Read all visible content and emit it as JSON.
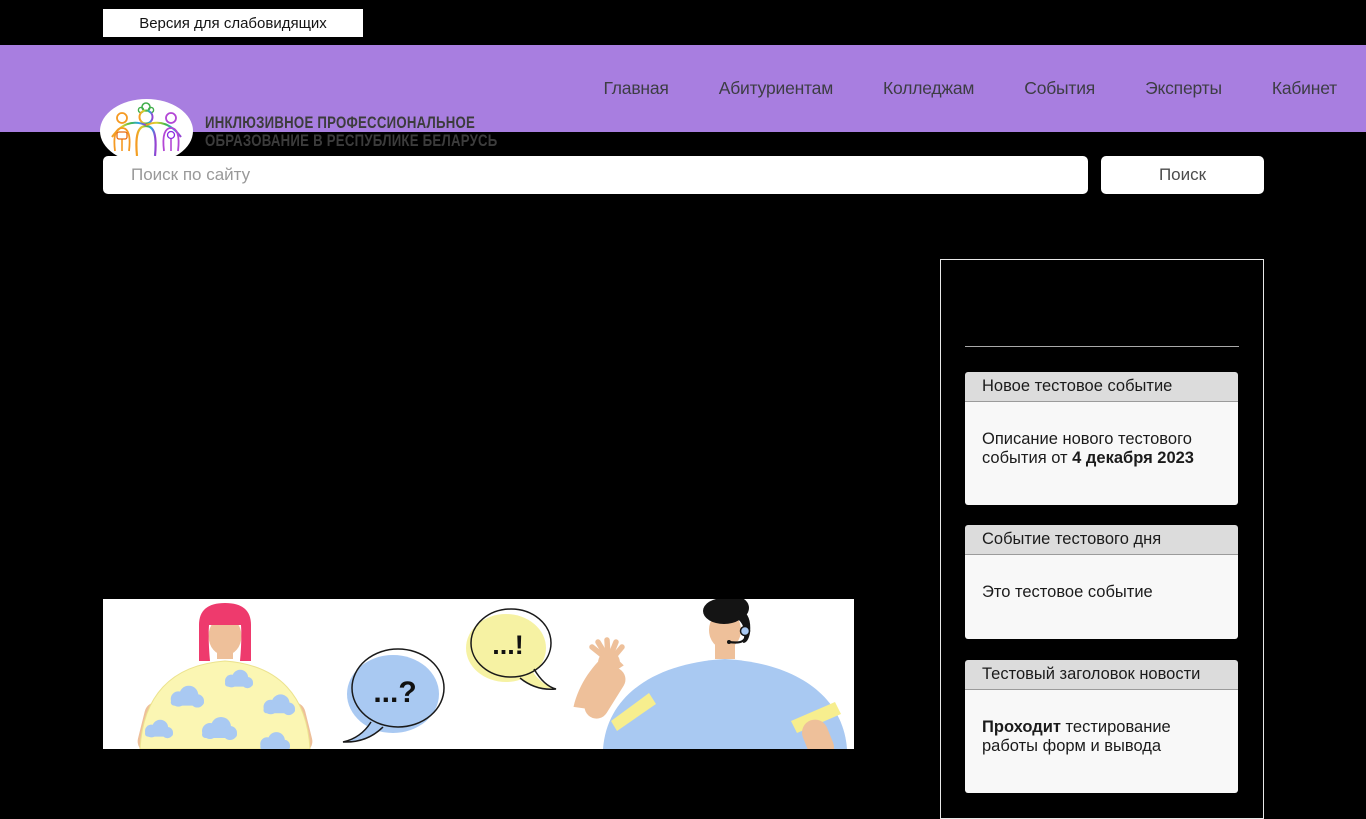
{
  "colors": {
    "header-purple": "#a87ee0",
    "card-header-bg": "#dcdcdc",
    "card-body-bg": "#f8f8f8",
    "bubble-blue": "#a9c9f2",
    "bubble-yellow": "#f6f2a3",
    "hair-pink": "#ee3a6d",
    "skin": "#eec09a",
    "shirt-yellow": "#fbf6b3",
    "shirt-blue": "#a9c9f2"
  },
  "top_bar": {
    "accessibility_button": "Версия для слабовидящих"
  },
  "header": {
    "site_title_line1": "ИНКЛЮЗИВНОЕ ПРОФЕССИОНАЛЬНОЕ",
    "site_title_line2": "ОБРАЗОВАНИЕ В РЕСПУБЛИКЕ БЕЛАРУСЬ",
    "nav": [
      "Главная",
      "Абитуриентам",
      "Колледжам",
      "События",
      "Эксперты",
      "Кабинет"
    ]
  },
  "search": {
    "placeholder": "Поиск по сайту",
    "button": "Поиск"
  },
  "sidebar": {
    "cards": [
      {
        "title": "Новое тестовое событие",
        "body_prefix": "Описание нового тестового события от ",
        "body_bold": "4 декабря 2023",
        "body_suffix": ""
      },
      {
        "title": "Событие тестового дня",
        "body_prefix": "Это тестовое событие",
        "body_bold": "",
        "body_suffix": ""
      },
      {
        "title": "Тестовый заголовок новости",
        "body_prefix": "",
        "body_bold": "Проходит",
        "body_suffix": " тестирование работы форм и вывода"
      }
    ]
  },
  "illustration": {
    "question_bubble": "...?",
    "exclaim_bubble": "...!"
  }
}
